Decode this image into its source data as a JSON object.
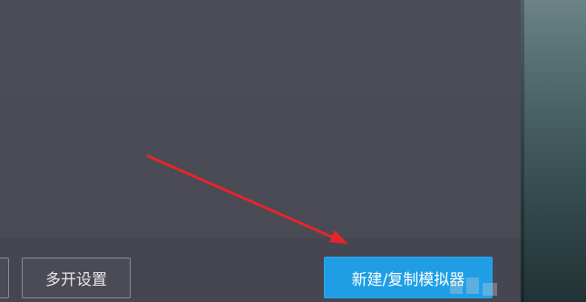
{
  "footer": {
    "multi_open_settings_label": "多开设置",
    "new_copy_emulator_label": "新建/复制模拟器"
  },
  "colors": {
    "background": "#4a4b55",
    "primary_button": "#1f9ee6",
    "annotation_arrow": "#e3262b"
  },
  "annotation": {
    "icon": "red-arrow-icon"
  }
}
